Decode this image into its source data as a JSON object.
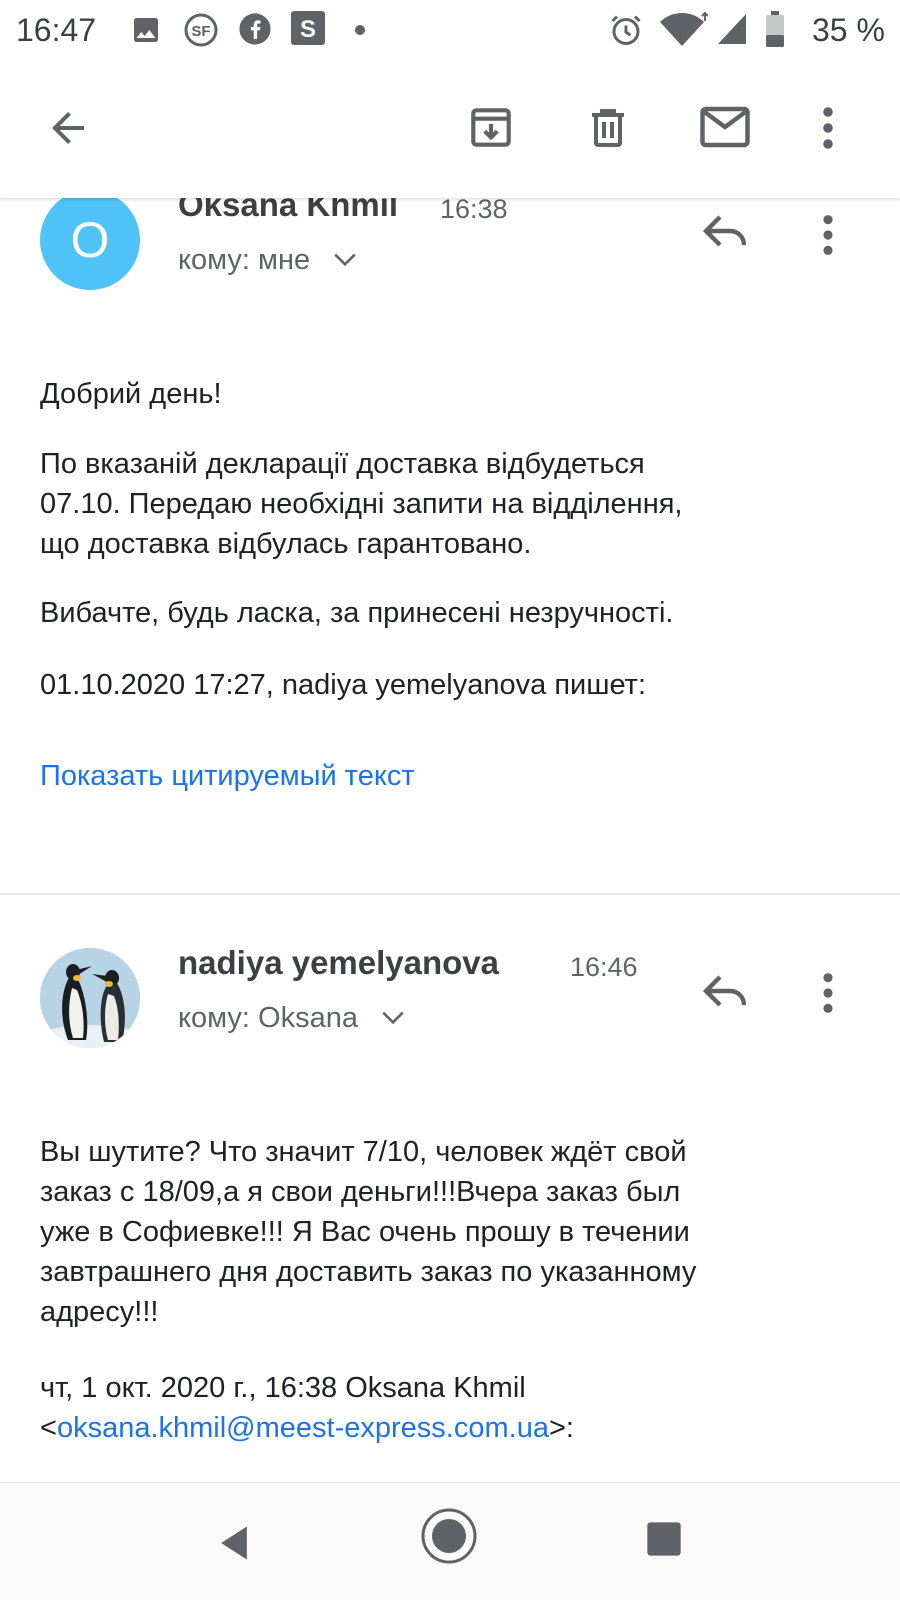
{
  "status_bar": {
    "time": "16:47",
    "battery": "35 %",
    "icons": [
      "image-icon",
      "sf-app-icon",
      "facebook-icon",
      "s-app-icon",
      "dot-icon",
      "alarm-icon",
      "wifi-icon",
      "signal-icon",
      "battery-icon"
    ]
  },
  "toolbar": {
    "icons": [
      "back-arrow-icon",
      "archive-icon",
      "delete-icon",
      "mark-unread-icon",
      "more-vert-icon"
    ]
  },
  "message1": {
    "avatar_letter": "O",
    "avatar_color": "#4fc3f7",
    "sender": "Oksana Khmil",
    "time": "16:38",
    "recipient": "кому: мне",
    "greeting": "Добрий день!",
    "paragraph1_line1": "По вказаній декларації доставка відбудеться",
    "paragraph1_line2": "07.10. Передаю необхідні запити на відділення,",
    "paragraph1_line3": "що доставка відбулась гарантовано.",
    "paragraph2": "Вибачте, будь ласка, за принесені незручності.",
    "quote_header": "01.10.2020 17:27, nadiya yemelyanova пишет:",
    "show_quoted": "Показать цитируемый текст"
  },
  "message2": {
    "sender": "nadiya yemelyanova",
    "time": "16:46",
    "recipient": "кому: Oksana",
    "body_line1": "Вы шутите? Что значит 7/10, человек ждёт свой",
    "body_line2": "заказ с 18/09,а я свои деньги!!!Вчера заказ был",
    "body_line3": "уже в Софиевке!!! Я Вас очень прошу в течении",
    "body_line4": "завтрашнего дня доставить заказ по указанному",
    "body_line5": "адресу!!!",
    "quote_line1": "чт, 1 окт. 2020 г., 16:38 Oksana Khmil",
    "quote_lt": "<",
    "quote_email": "oksana.khmil@meest-express.com.ua",
    "quote_gt": ">:"
  },
  "colors": {
    "link": "#1a73e8",
    "text_primary": "#202124",
    "text_secondary": "#5f6368"
  }
}
